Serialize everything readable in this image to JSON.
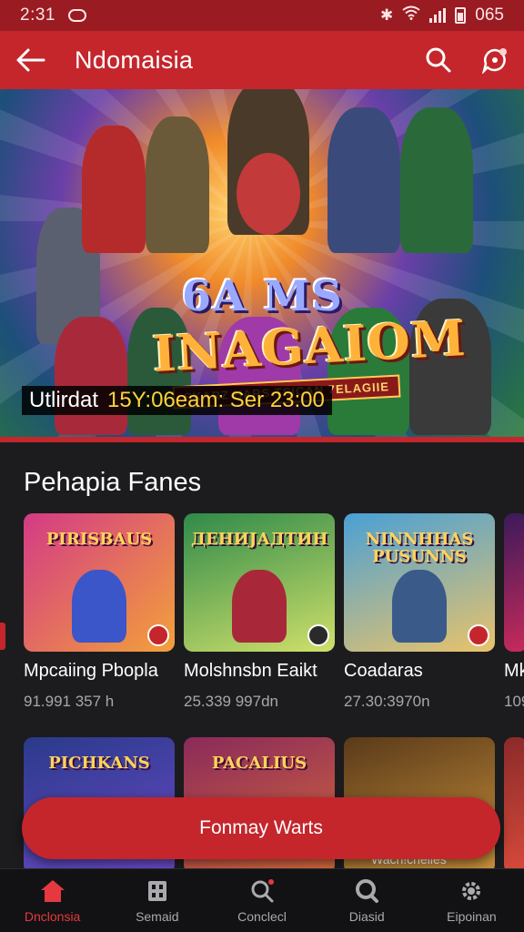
{
  "status_bar": {
    "time": "2:31",
    "battery": "065"
  },
  "app_bar": {
    "title": "Ndomaisia"
  },
  "hero": {
    "logo_line1": "6A MS",
    "logo_line2": "INAGAIOM",
    "tagline": "SKARZ HARS TSICAN 7ELAGIIE",
    "update_label": "Utlirdat",
    "update_value": "15Y:06eam: Ser 23:00"
  },
  "section": {
    "title": "Pehapia Fanes"
  },
  "games": [
    {
      "name": "Mpcaiing Pbopla",
      "meta": "91.991 357 h",
      "thumb_title": "PIRISBAUS",
      "bg": "#d33a86",
      "bg2": "#f3a13a",
      "fig": "#3a56c8"
    },
    {
      "name": "Molshnsbn Eaikt",
      "meta": "25.339 997dn",
      "thumb_title": "ДЕНИЈАДТИН",
      "bg": "#2f8a4a",
      "bg2": "#cfe06a",
      "fig": "#a8283a"
    },
    {
      "name": "Coadaras",
      "meta": "27.30:3970n",
      "thumb_title": "NINNHHAS PUSUNNS",
      "bg": "#4aa0d6",
      "bg2": "#e9c36a",
      "fig": "#3a5a8a"
    },
    {
      "name": "Mk",
      "meta": "109",
      "thumb_title": "",
      "bg": "#3a1a5a",
      "bg2": "#c82a5a",
      "fig": "#e0a030"
    }
  ],
  "games_row2": [
    {
      "thumb_title": "PICHKANS",
      "bg": "#2a3a8a",
      "bg2": "#6a4ac8"
    },
    {
      "thumb_title": "PACALIUS",
      "bg": "#8a2a5a",
      "bg2": "#d86a3a"
    },
    {
      "thumb_title": "",
      "bg": "#5a3a1a",
      "bg2": "#c8903a"
    },
    {
      "thumb_title": "",
      "bg": "#8a2a2a",
      "bg2": "#d84a3a"
    }
  ],
  "row2_caption": "Wacn!cnelles",
  "fab": {
    "label": "Fonmay Warts"
  },
  "bottom_nav": [
    {
      "label": "Dnclonsia",
      "icon": "home-icon"
    },
    {
      "label": "Semaid",
      "icon": "grid-icon"
    },
    {
      "label": "Conclecl",
      "icon": "search-icon"
    },
    {
      "label": "Diasid",
      "icon": "search-icon"
    },
    {
      "label": "Eipoinan",
      "icon": "gear-icon"
    }
  ],
  "colors": {
    "primary": "#c4262c",
    "status": "#9a1b22",
    "accent_text": "#ffd23a"
  }
}
